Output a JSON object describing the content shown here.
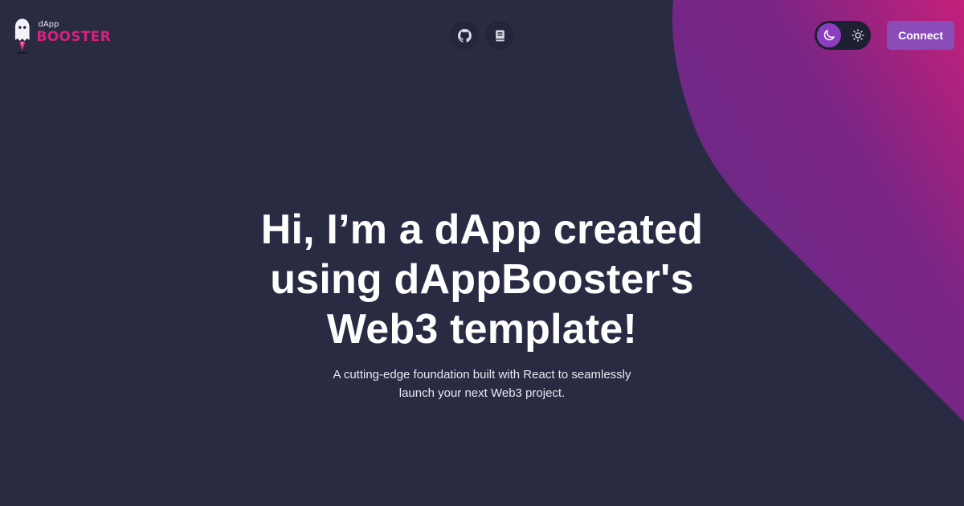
{
  "brand": {
    "small_text": "dApp",
    "big_text": "BOOSTER",
    "accent_color": "#d4237a"
  },
  "header": {
    "icon_links": [
      {
        "icon": "github-icon"
      },
      {
        "icon": "book-icon"
      }
    ],
    "theme_toggle": {
      "active_icon": "moon-icon",
      "inactive_icon": "sun-icon",
      "mode": "dark"
    },
    "connect_label": "Connect",
    "connect_color": "#8a4cb8"
  },
  "hero": {
    "title_lines": [
      "Hi, I’m a dApp created",
      "using dAppBooster's",
      "Web3 template!"
    ],
    "subtitle_lines": [
      "A cutting-edge foundation built with React to seamlessly",
      "launch your next Web3 project."
    ]
  },
  "theme": {
    "background": "#292b43",
    "gradient_start": "#6a2a86",
    "gradient_end": "#c2207a"
  }
}
